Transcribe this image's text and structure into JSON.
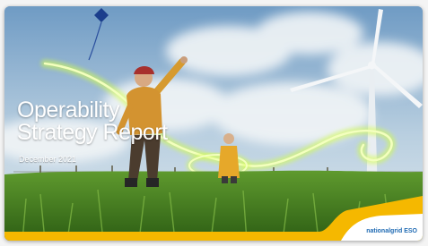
{
  "report": {
    "title_line1": "Operability",
    "title_line2": "Strategy Report",
    "date": "December 2021",
    "brand": "nationalgrid ESO"
  },
  "colors": {
    "sky": "#8fb3cf",
    "grass": "#3e7a1f",
    "accent_yellow": "#f5b800",
    "glow_green": "#d6ff4a",
    "brand_blue": "#1f6ab3"
  }
}
